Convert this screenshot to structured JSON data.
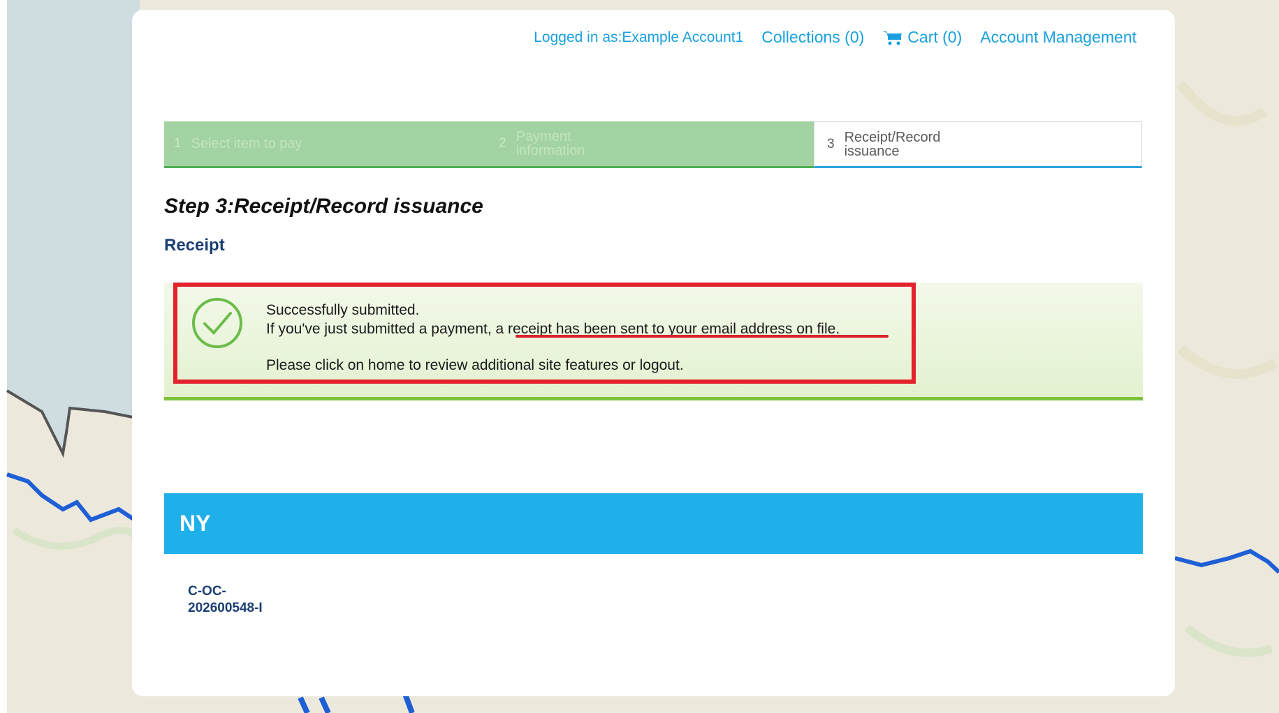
{
  "topnav": {
    "logged_in_label": "Logged in as:Example Account1",
    "collections": "Collections (0)",
    "cart": "Cart (0)",
    "account": "Account Management"
  },
  "steps": [
    {
      "num": "1",
      "label": "Select item to pay",
      "state": "done"
    },
    {
      "num": "2",
      "label": "Payment information",
      "state": "done"
    },
    {
      "num": "3",
      "label": "Receipt/Record issuance",
      "state": "current"
    }
  ],
  "page_title": "Step 3:Receipt/Record issuance",
  "receipt_heading": "Receipt",
  "success": {
    "line1": "Successfully submitted.",
    "line2_prefix": "If you've just submitted a payment, ",
    "line2_link": "a receipt has been sent to your email address on file",
    "line2_suffix": ".",
    "line3": "Please click on home to review additional site features or logout."
  },
  "record_group": {
    "title": "NY",
    "record_id": "C-OC-202600548-I"
  },
  "colors": {
    "accent": "#1fafe9",
    "success_bar": "#7dc23c",
    "highlight": "#e3222b",
    "step_done": "#a3d3a2"
  },
  "icons": [
    "cart-icon",
    "check-circle-icon"
  ]
}
